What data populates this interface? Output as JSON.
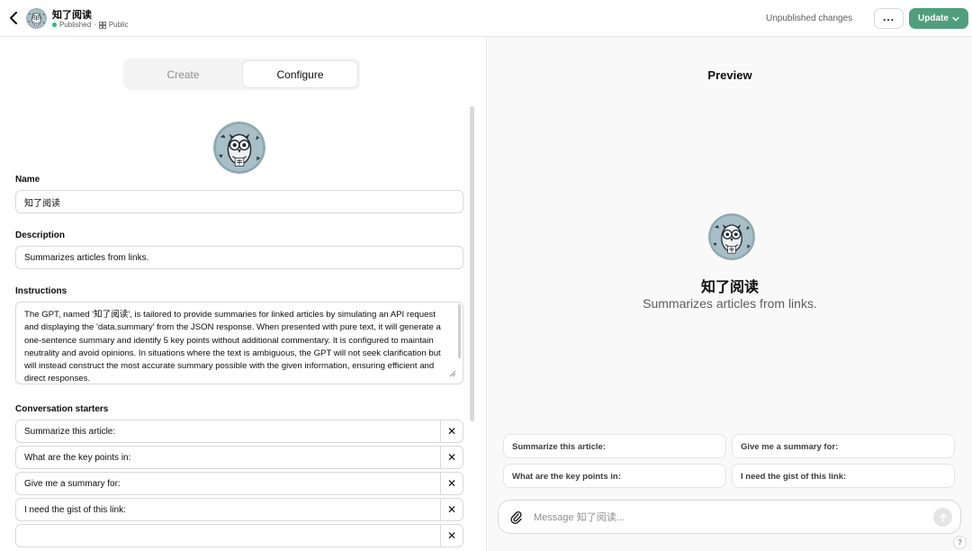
{
  "header": {
    "title": "知了阅读",
    "status": "Published",
    "separator": "·",
    "visibility": "Public",
    "unpublished_label": "Unpublished changes",
    "more_label": "...",
    "update_label": "Update"
  },
  "tabs": [
    {
      "label": "Create",
      "active": false
    },
    {
      "label": "Configure",
      "active": true
    }
  ],
  "config": {
    "name_label": "Name",
    "name_value": "知了阅读",
    "description_label": "Description",
    "description_value": "Summarizes articles from links.",
    "instructions_label": "Instructions",
    "instructions_value": "The GPT, named '知了阅读', is tailored to provide summaries for linked articles by simulating an API request and displaying the 'data.summary' from the JSON response. When presented with pure text, it will generate a one-sentence summary and identify 5 key points without additional commentary. It is configured to maintain neutrality and avoid opinions. In situations where the text is ambiguous, the GPT will not seek clarification but will instead construct the most accurate summary possible with the given information, ensuring efficient and direct responses.",
    "starters_label": "Conversation starters",
    "starters": [
      "Summarize this article:",
      "What are the key points in:",
      "Give me a summary for:",
      "I need the gist of this link:",
      ""
    ],
    "remove_symbol": "✕"
  },
  "preview": {
    "title": "Preview",
    "gpt_name": "知了阅读",
    "gpt_description": "Summarizes articles from links.",
    "chips": [
      "Summarize this article:",
      "Give me a summary for:",
      "What are the key points in:",
      "I need the gist of this link:"
    ],
    "composer_placeholder": "Message 知了阅读...",
    "help_label": "?"
  },
  "colors": {
    "accent": "#4f9f7c",
    "published_dot": "#19c37d",
    "avatar_bg": "#8fa9b3"
  }
}
